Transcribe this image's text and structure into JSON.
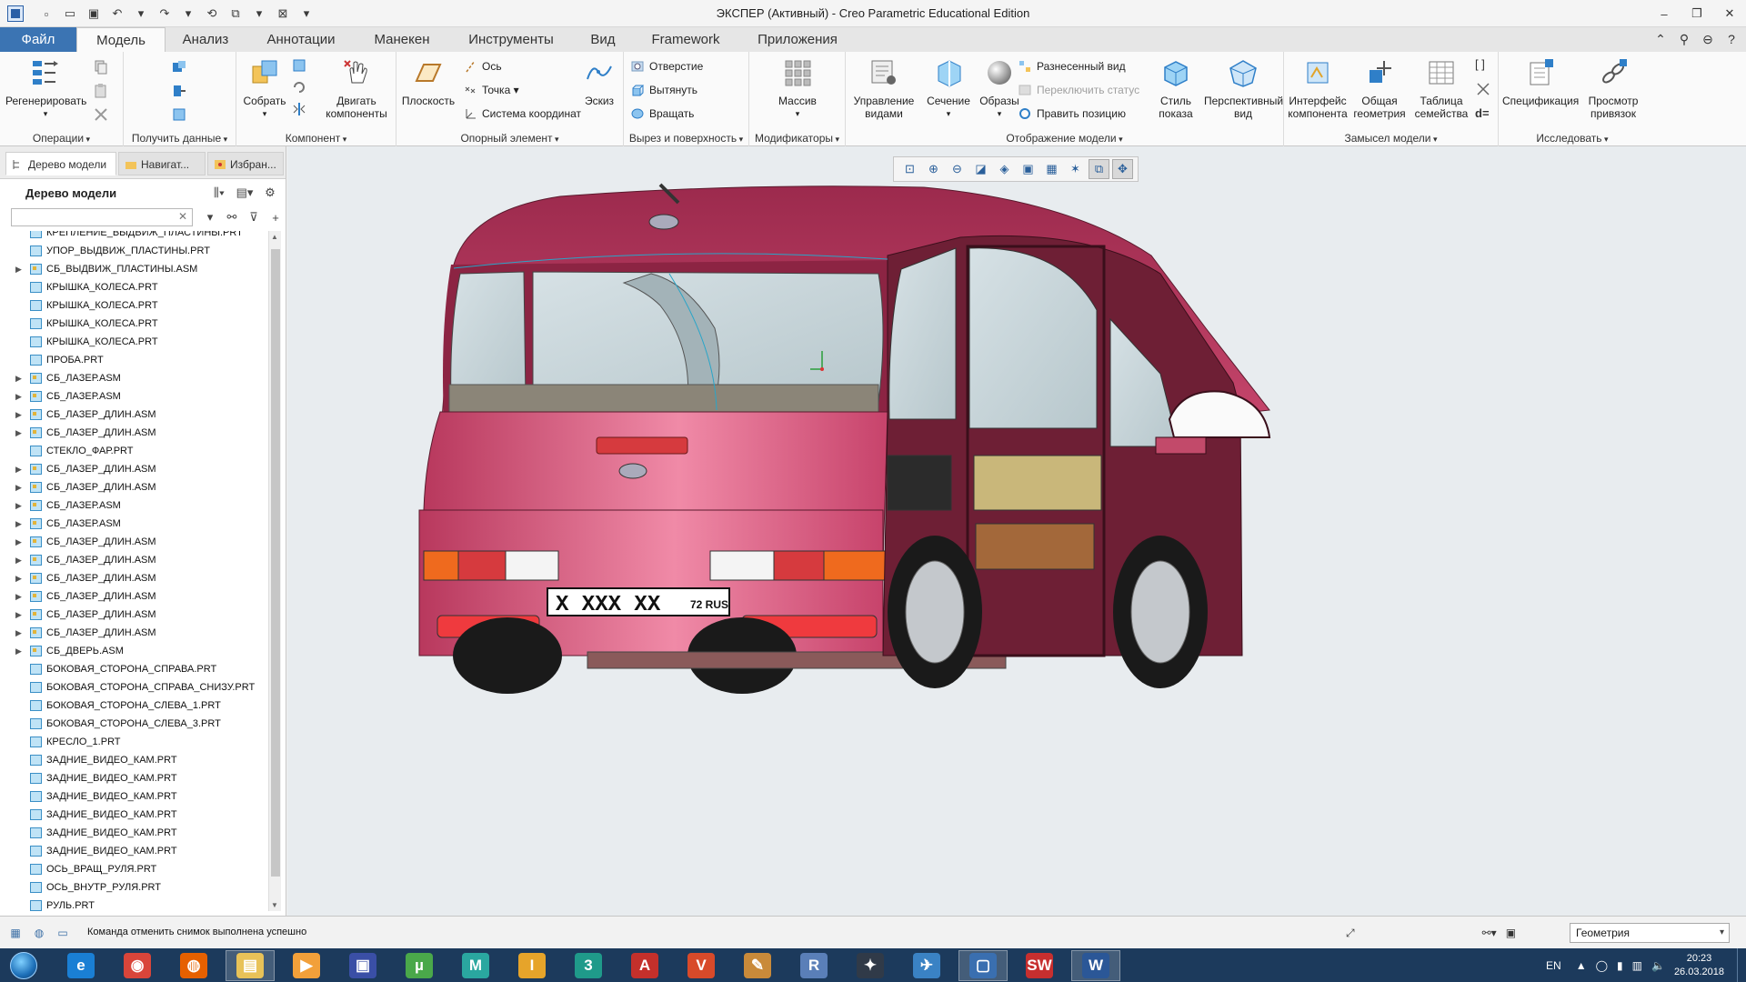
{
  "window": {
    "title": "ЭКСПЕР (Активный) - Creo Parametric Educational Edition",
    "controls": [
      "–",
      "❐",
      "✕"
    ]
  },
  "tabs": [
    {
      "label": "Файл"
    },
    {
      "label": "Модель"
    },
    {
      "label": "Анализ"
    },
    {
      "label": "Аннотации"
    },
    {
      "label": "Манекен"
    },
    {
      "label": "Инструменты"
    },
    {
      "label": "Вид"
    },
    {
      "label": "Framework"
    },
    {
      "label": "Приложения"
    }
  ],
  "ribbon": {
    "groups": {
      "operations": "Операции",
      "get_data": "Получить данные",
      "component": "Компонент",
      "datum": "Опорный элемент",
      "cut_surface": "Вырез и поверхность",
      "modifiers": "Модификаторы",
      "model_display": "Отображение модели",
      "design_intent": "Замысел модели",
      "investigate": "Исследовать"
    },
    "buttons": {
      "regenerate": "Регенерировать",
      "assemble": "Собрать",
      "drag_line1": "Двигать",
      "drag_line2": "компоненты",
      "plane": "Плоскость",
      "axis": "Ось",
      "point": "Точка",
      "csys": "Система координат",
      "sketch": "Эскиз",
      "hole": "Отверстие",
      "extrude": "Вытянуть",
      "revolve": "Вращать",
      "pattern": "Массив",
      "manage_views_line1": "Управление",
      "manage_views_line2": "видами",
      "section": "Сечение",
      "appearances": "Образы",
      "exploded_view": "Разнесенный вид",
      "toggle_status": "Переключить статус",
      "edit_position": "Править позицию",
      "display_style_line1": "Стиль",
      "display_style_line2": "показа",
      "perspective_line1": "Перспективный",
      "perspective_line2": "вид",
      "component_interface_line1": "Интерфейс",
      "component_interface_line2": "компонента",
      "shared_geometry_line1": "Общая",
      "shared_geometry_line2": "геометрия",
      "family_table_line1": "Таблица",
      "family_table_line2": "семейства",
      "d_symbol": "d=",
      "bom": "Спецификация",
      "view_refs_line1": "Просмотр",
      "view_refs_line2": "привязок"
    }
  },
  "left_panel": {
    "tabs": [
      {
        "label": "Дерево модели"
      },
      {
        "label": "Навигат..."
      },
      {
        "label": "Избран..."
      }
    ],
    "tree_title": "Дерево модели",
    "search_placeholder": "",
    "items": [
      {
        "name": "КРЕПЛЕНИЕ_ВЫДВИЖ_ПЛАСТИНЫ.PRT",
        "expandable": false
      },
      {
        "name": "УПОР_ВЫДВИЖ_ПЛАСТИНЫ.PRT",
        "expandable": false
      },
      {
        "name": "СБ_ВЫДВИЖ_ПЛАСТИНЫ.ASM",
        "expandable": true
      },
      {
        "name": "КРЫШКА_КОЛЕСА.PRT",
        "expandable": false
      },
      {
        "name": "КРЫШКА_КОЛЕСА.PRT",
        "expandable": false
      },
      {
        "name": "КРЫШКА_КОЛЕСА.PRT",
        "expandable": false
      },
      {
        "name": "КРЫШКА_КОЛЕСА.PRT",
        "expandable": false
      },
      {
        "name": "ПРОБА.PRT",
        "expandable": false
      },
      {
        "name": "СБ_ЛАЗЕР.ASM",
        "expandable": true
      },
      {
        "name": "СБ_ЛАЗЕР.ASM",
        "expandable": true
      },
      {
        "name": "СБ_ЛАЗЕР_ДЛИН.ASM",
        "expandable": true
      },
      {
        "name": "СБ_ЛАЗЕР_ДЛИН.ASM",
        "expandable": true
      },
      {
        "name": "СТЕКЛО_ФАР.PRT",
        "expandable": false
      },
      {
        "name": "СБ_ЛАЗЕР_ДЛИН.ASM",
        "expandable": true
      },
      {
        "name": "СБ_ЛАЗЕР_ДЛИН.ASM",
        "expandable": true
      },
      {
        "name": "СБ_ЛАЗЕР.ASM",
        "expandable": true
      },
      {
        "name": "СБ_ЛАЗЕР.ASM",
        "expandable": true
      },
      {
        "name": "СБ_ЛАЗЕР_ДЛИН.ASM",
        "expandable": true
      },
      {
        "name": "СБ_ЛАЗЕР_ДЛИН.ASM",
        "expandable": true
      },
      {
        "name": "СБ_ЛАЗЕР_ДЛИН.ASM",
        "expandable": true
      },
      {
        "name": "СБ_ЛАЗЕР_ДЛИН.ASM",
        "expandable": true
      },
      {
        "name": "СБ_ЛАЗЕР_ДЛИН.ASM",
        "expandable": true
      },
      {
        "name": "СБ_ЛАЗЕР_ДЛИН.ASM",
        "expandable": true
      },
      {
        "name": "СБ_ДВЕРЬ.ASM",
        "expandable": true
      },
      {
        "name": "БОКОВАЯ_СТОРОНА_СПРАВА.PRT",
        "expandable": false
      },
      {
        "name": "БОКОВАЯ_СТОРОНА_СПРАВА_СНИЗУ.PRT",
        "expandable": false
      },
      {
        "name": "БОКОВАЯ_СТОРОНА_СЛЕВА_1.PRT",
        "expandable": false
      },
      {
        "name": "БОКОВАЯ_СТОРОНА_СЛЕВА_3.PRT",
        "expandable": false
      },
      {
        "name": "КРЕСЛО_1.PRT",
        "expandable": false
      },
      {
        "name": "ЗАДНИЕ_ВИДЕО_КАМ.PRT",
        "expandable": false
      },
      {
        "name": "ЗАДНИЕ_ВИДЕО_КАМ.PRT",
        "expandable": false
      },
      {
        "name": "ЗАДНИЕ_ВИДЕО_КАМ.PRT",
        "expandable": false
      },
      {
        "name": "ЗАДНИЕ_ВИДЕО_КАМ.PRT",
        "expandable": false
      },
      {
        "name": "ЗАДНИЕ_ВИДЕО_КАМ.PRT",
        "expandable": false
      },
      {
        "name": "ЗАДНИЕ_ВИДЕО_КАМ.PRT",
        "expandable": false
      },
      {
        "name": "ОСЬ_ВРАЩ_РУЛЯ.PRT",
        "expandable": false
      },
      {
        "name": "ОСЬ_ВНУТР_РУЛЯ.PRT",
        "expandable": false
      },
      {
        "name": "РУЛЬ.PRT",
        "expandable": false
      }
    ]
  },
  "viewport": {
    "plate_number": "X XXX XX",
    "plate_region": "72 RUS",
    "colors": {
      "body": "#c2406a",
      "body_dark": "#6e1f35",
      "glass": "#c9d6da",
      "background": "#e8ecef"
    }
  },
  "status": {
    "message": "Команда отменить снимок выполнена успешно",
    "filter_value": "Геометрия"
  },
  "taskbar": {
    "apps": [
      {
        "name": "ie-icon",
        "glyph": "e",
        "color": "#1a7fd4"
      },
      {
        "name": "chrome-icon",
        "glyph": "◉",
        "color": "#d9453a"
      },
      {
        "name": "firefox-icon",
        "glyph": "◍",
        "color": "#e66000"
      },
      {
        "name": "explorer-icon",
        "glyph": "▤",
        "color": "#e8c258"
      },
      {
        "name": "media-icon",
        "glyph": "▶",
        "color": "#f2a03a"
      },
      {
        "name": "floppy-icon",
        "glyph": "▣",
        "color": "#3a4fa6"
      },
      {
        "name": "utorrent-icon",
        "glyph": "µ",
        "color": "#4aa84a"
      },
      {
        "name": "mathcad-icon",
        "glyph": "M",
        "color": "#2aa7a0"
      },
      {
        "name": "inventor-icon",
        "glyph": "I",
        "color": "#e6a42a"
      },
      {
        "name": "3ds-icon",
        "glyph": "3",
        "color": "#1f9a8a"
      },
      {
        "name": "autocad-icon",
        "glyph": "A",
        "color": "#c4302b"
      },
      {
        "name": "kompas-icon",
        "glyph": "V",
        "color": "#d84a2a"
      },
      {
        "name": "pencil-icon",
        "glyph": "✎",
        "color": "#c98a3a"
      },
      {
        "name": "r-icon",
        "glyph": "R",
        "color": "#5a7fb8"
      },
      {
        "name": "catia-icon",
        "glyph": "✦",
        "color": "#303a48"
      },
      {
        "name": "plane-icon",
        "glyph": "✈",
        "color": "#3a82c4"
      },
      {
        "name": "creo-icon",
        "glyph": "▢",
        "color": "#3a6fb0"
      },
      {
        "name": "solidworks-icon",
        "glyph": "SW",
        "color": "#c72f2f"
      },
      {
        "name": "word-icon",
        "glyph": "W",
        "color": "#2b5797"
      }
    ],
    "language": "EN",
    "time": "20:23",
    "date": "26.03.2018"
  }
}
